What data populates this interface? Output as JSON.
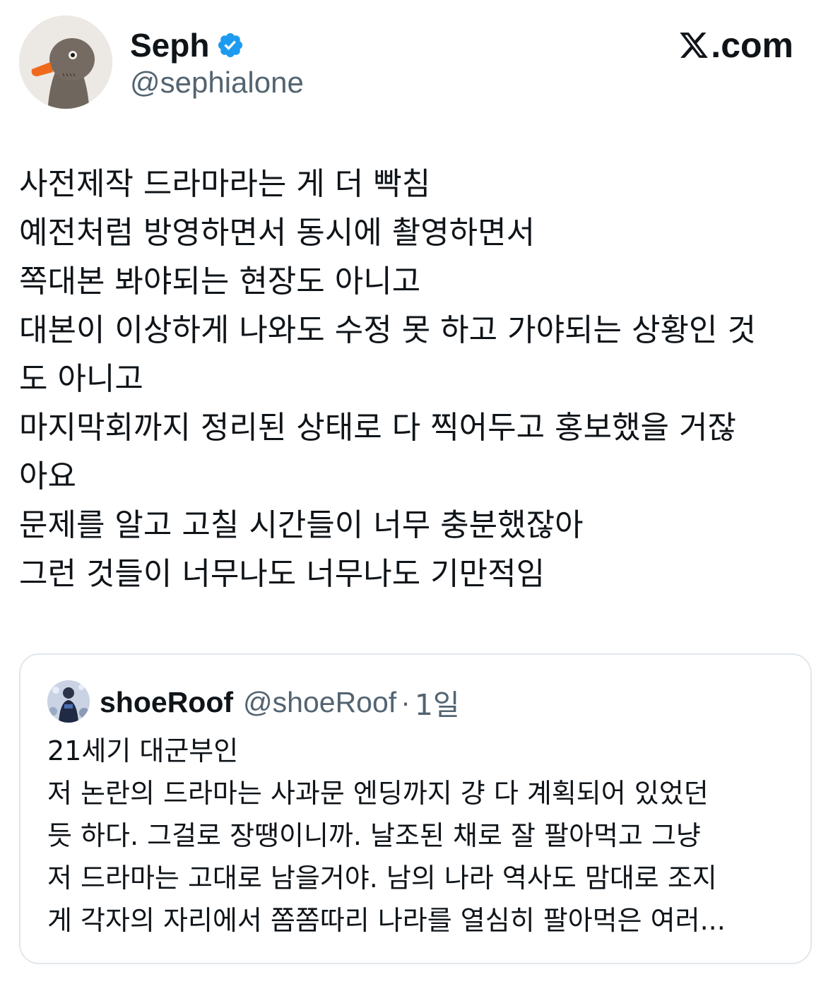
{
  "author": {
    "display_name": "Seph",
    "handle": "@sephialone",
    "verified_icon": "verified-badge-icon",
    "avatar_icon": "goose-plush-avatar"
  },
  "brand": {
    "text": ".com",
    "icon": "x-logo-icon"
  },
  "tweet": {
    "lines": [
      "사전제작 드라마라는 게 더 빡침",
      "예전처럼 방영하면서 동시에 촬영하면서",
      "쪽대본 봐야되는 현장도 아니고",
      "대본이 이상하게 나와도 수정 못 하고 가야되는 상황인 것",
      "도 아니고",
      "마지막회까지 정리된 상태로 다 찍어두고 홍보했을 거잖",
      "아요",
      "문제를 알고 고칠 시간들이 너무 충분했잖아",
      "그런 것들이 너무나도 너무나도 기만적임"
    ]
  },
  "quoted": {
    "display_name": "shoeRoof",
    "handle": "@shoeRoof",
    "separator": "·",
    "time": "1일",
    "avatar_icon": "person-photo-avatar",
    "lines": [
      "21세기 대군부인",
      "저 논란의 드라마는 사과문 엔딩까지 걍 다 계획되어 있었던",
      "듯 하다. 그걸로 장땡이니까. 날조된 채로 잘 팔아먹고 그냥",
      "저 드라마는 고대로 남을거야. 남의 나라 역사도 맘대로 조지",
      "게 각자의 자리에서 쫌쫌따리 나라를 열심히 팔아먹은 여러..."
    ]
  },
  "colors": {
    "text_primary": "#0f1419",
    "text_secondary": "#536471",
    "verified_blue": "#1d9bf0",
    "card_border": "#e2e7eb"
  }
}
